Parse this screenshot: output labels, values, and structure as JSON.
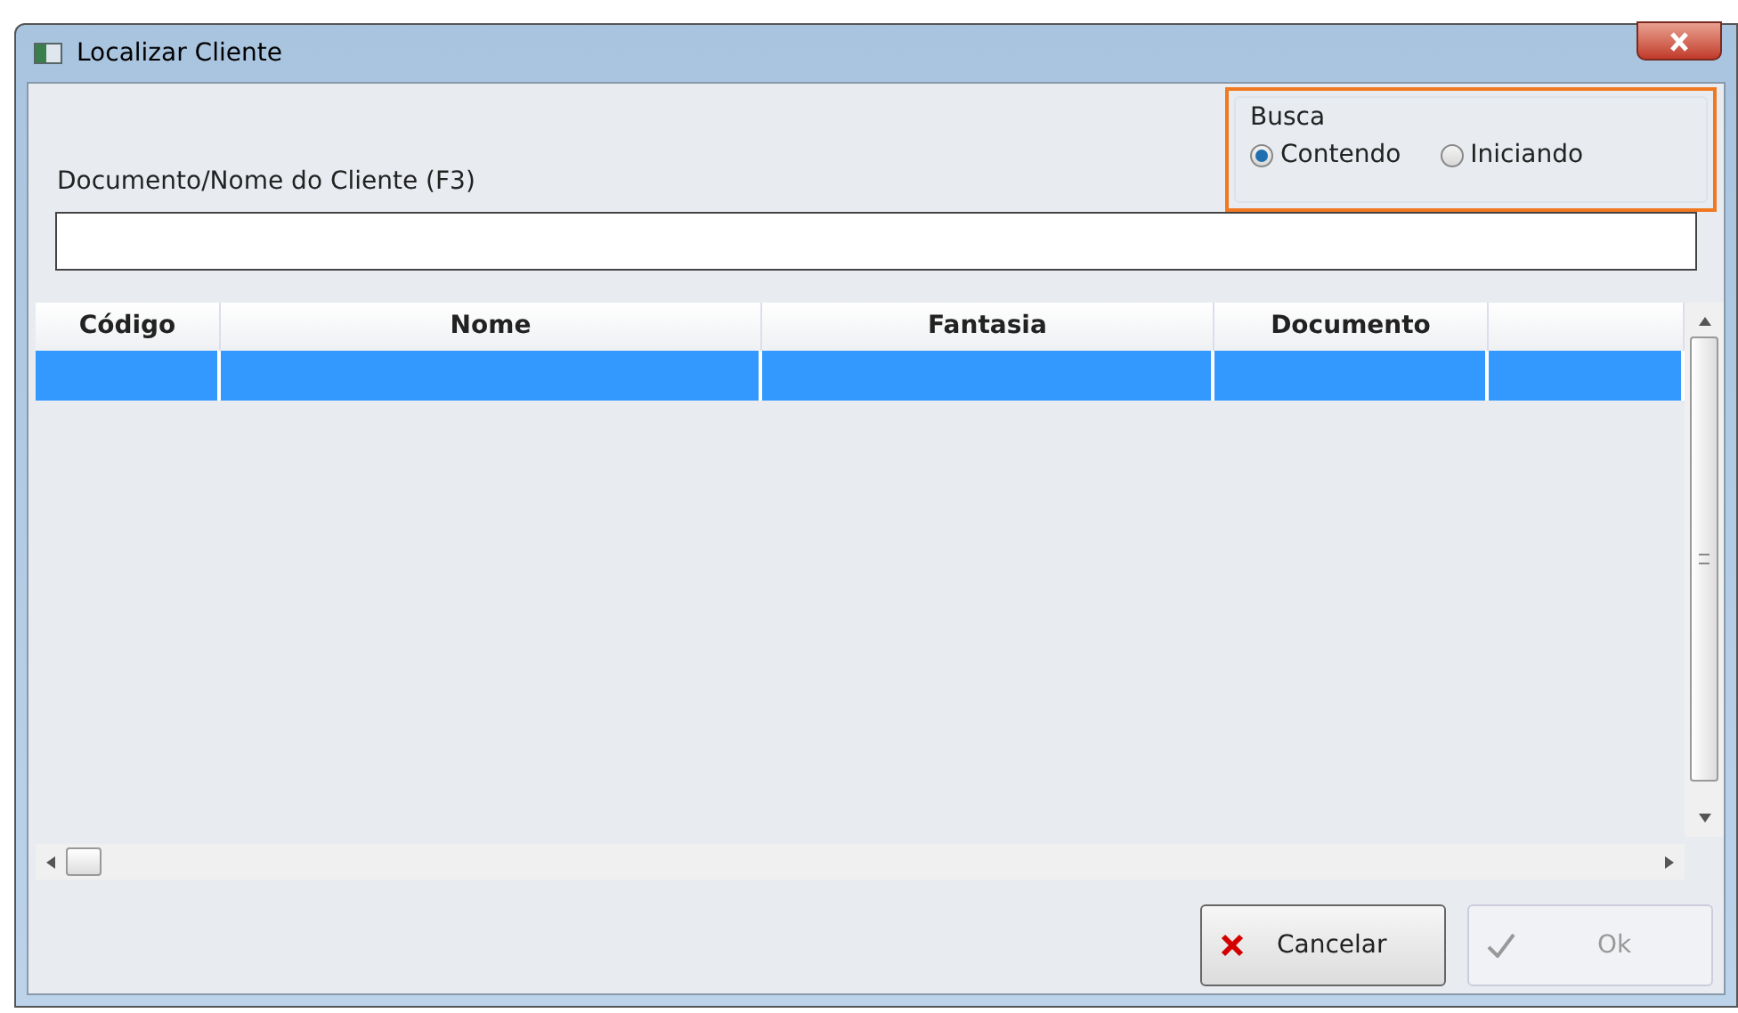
{
  "window": {
    "title": "Localizar Cliente"
  },
  "search_field": {
    "label": "Documento/Nome do Cliente (F3)"
  },
  "search_mode": {
    "title": "Busca",
    "highlighted": true,
    "options": [
      {
        "label": "Contendo",
        "selected": true
      },
      {
        "label": "Iniciando",
        "selected": false
      }
    ]
  },
  "table": {
    "columns": [
      "Código",
      "Nome",
      "Fantasia",
      "Documento",
      ""
    ],
    "rows": [
      {
        "selected": true,
        "cells": [
          "",
          "",
          "",
          "",
          ""
        ]
      }
    ]
  },
  "buttons": [
    {
      "kind": "cancel",
      "label": "Cancelar",
      "disabled": false
    },
    {
      "kind": "ok",
      "label": "Ok",
      "disabled": true
    }
  ]
}
